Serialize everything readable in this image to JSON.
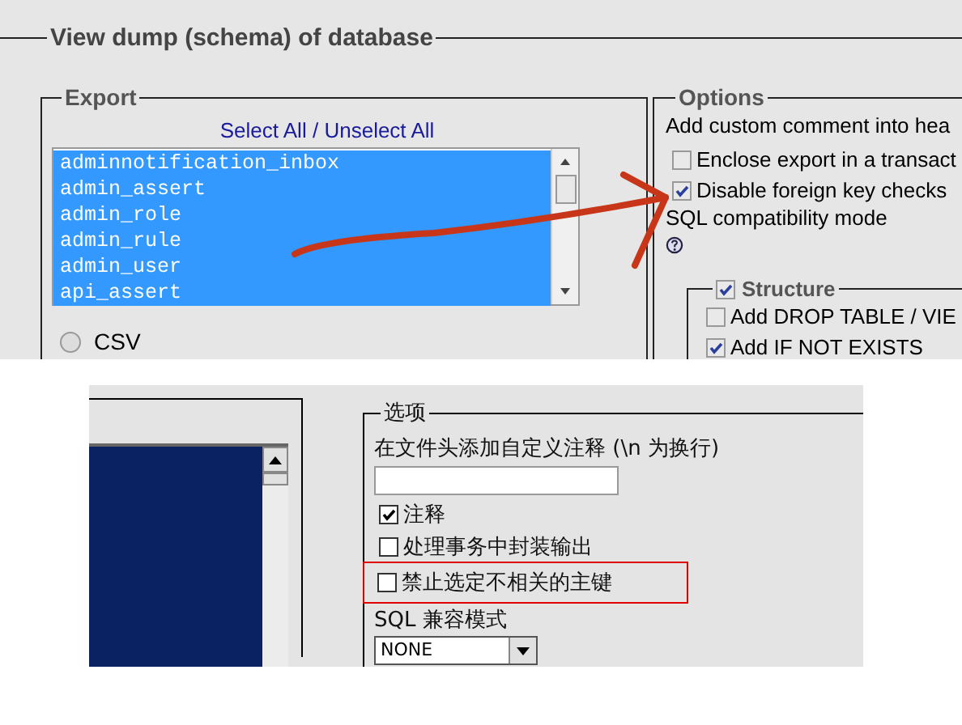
{
  "top": {
    "title": "View dump (schema) of database",
    "export": {
      "legend": "Export",
      "select_all": "Select All",
      "separator": "/",
      "unselect_all": "Unselect All",
      "tables": [
        {
          "name": "adminnotification_inbox",
          "selected": true
        },
        {
          "name": "admin_assert",
          "selected": true
        },
        {
          "name": "admin_role",
          "selected": true
        },
        {
          "name": "admin_rule",
          "selected": true
        },
        {
          "name": "admin_user",
          "selected": true
        },
        {
          "name": "api_assert",
          "selected": true
        }
      ],
      "formats": [
        {
          "label": "CSV",
          "selected": false
        }
      ]
    },
    "options": {
      "legend": "Options",
      "comment_label": "Add custom comment into hea",
      "checkboxes": [
        {
          "label": "Enclose export in a transact",
          "checked": false
        },
        {
          "label": "Disable foreign key checks",
          "checked": true
        }
      ],
      "compat_label": "SQL compatibility mode",
      "structure": {
        "legend": "Structure",
        "checked": true,
        "checkboxes": [
          {
            "label": "Add DROP TABLE / VIE",
            "checked": false
          },
          {
            "label": "Add IF NOT EXISTS",
            "checked": true
          }
        ]
      }
    }
  },
  "bottom": {
    "options": {
      "legend": "选项",
      "comment_label": "在文件头添加自定义注释 (\\n 为换行)",
      "checkboxes": [
        {
          "label": "注释",
          "checked": true,
          "highlighted": false
        },
        {
          "label": "处理事务中封装输出",
          "checked": false,
          "highlighted": false
        },
        {
          "label": "禁止选定不相关的主键",
          "checked": false,
          "highlighted": true
        }
      ],
      "compat_label": "SQL 兼容模式",
      "compat_value": "NONE"
    }
  }
}
